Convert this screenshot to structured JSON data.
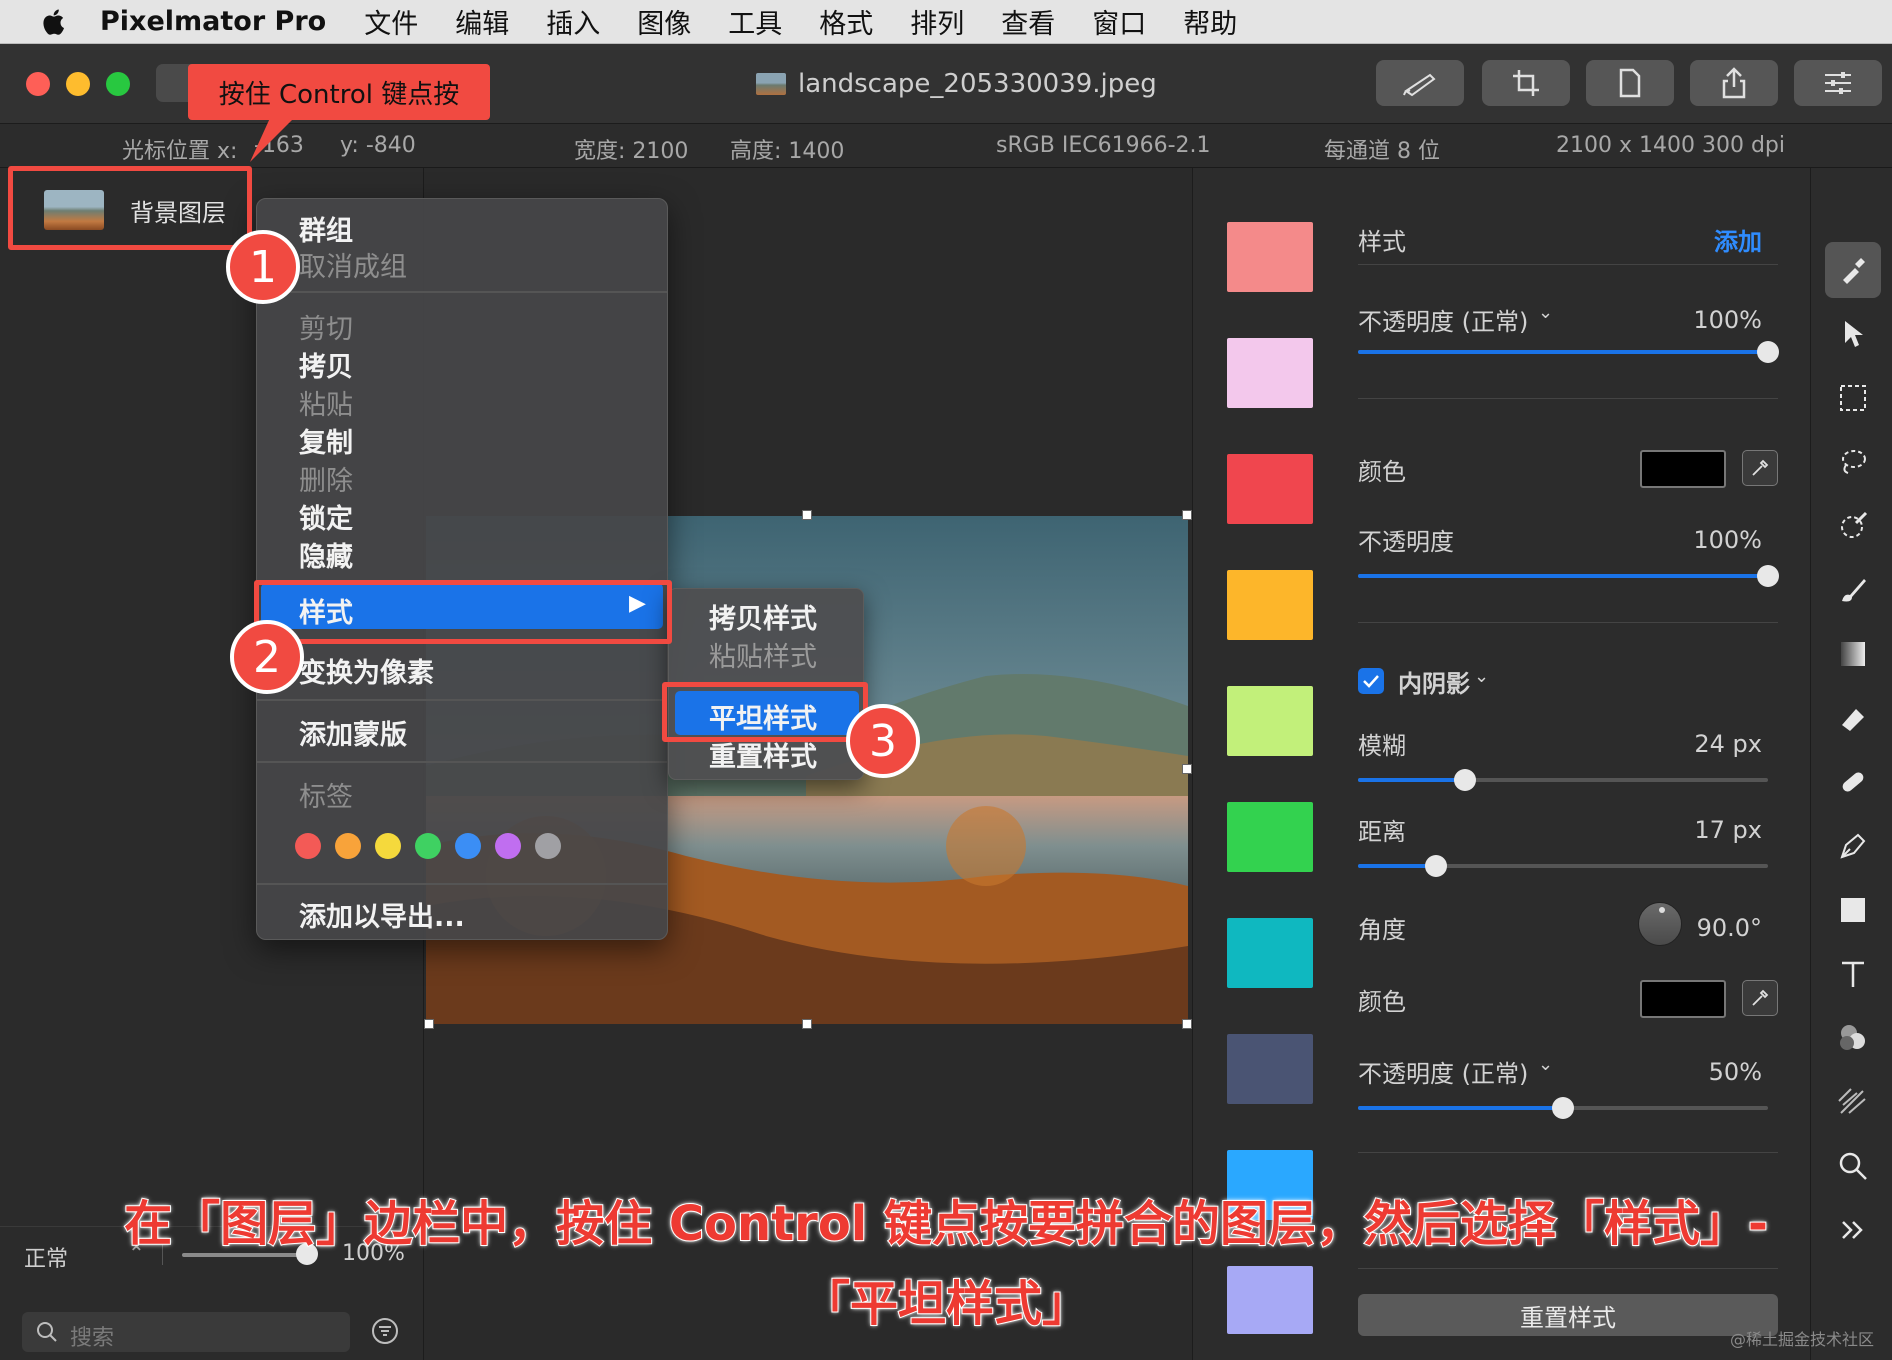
{
  "menubar": {
    "app_name": "Pixelmator Pro",
    "items": [
      "文件",
      "编辑",
      "插入",
      "图像",
      "工具",
      "格式",
      "排列",
      "查看",
      "窗口",
      "帮助"
    ]
  },
  "window": {
    "title": "landscape_205330039.jpeg"
  },
  "infobar": {
    "cursor_label": "光标位置 x:",
    "cursor_x": "-163",
    "cursor_y": "y:  -840",
    "width": "宽度:  2100",
    "height": "高度:  1400",
    "color_profile": "sRGB IEC61966-2.1",
    "bit_depth": "每通道 8 位",
    "dimensions": "2100 x 1400 300 dpi"
  },
  "layers": {
    "layer_name": "背景图层",
    "blend_mode": "正常",
    "opacity": "100%",
    "search_placeholder": "搜索"
  },
  "context_menu": {
    "group": "群组",
    "ungroup": "取消成组",
    "cut": "剪切",
    "copy": "拷贝",
    "paste": "粘贴",
    "duplicate": "复制",
    "delete": "删除",
    "lock": "锁定",
    "hide": "隐藏",
    "styles": "样式",
    "convert": "变换为像素",
    "add_mask": "添加蒙版",
    "tags": "标签",
    "tag_colors": [
      "#f35a56",
      "#f8a33a",
      "#f5d93c",
      "#3fd162",
      "#3b8ef5",
      "#c06ef0",
      "#a0a0a4"
    ],
    "add_export": "添加以导出..."
  },
  "submenu": {
    "copy_style": "拷贝样式",
    "paste_style": "粘贴样式",
    "flatten_style": "平坦样式",
    "reset_style": "重置样式"
  },
  "annotations": {
    "callout": "按住 Control 键点按",
    "badge1": "1",
    "badge2": "2",
    "badge3": "3",
    "caption_line1": "在「图层」边栏中，按住 Control 键点按要拼合的图层，然后选择「样式」-",
    "caption_line2": "「平坦样式」",
    "accent_color": "#f14a41"
  },
  "swatches": [
    "#f48a8a",
    "#f3c8ec",
    "#f0464e",
    "#fdb62a",
    "#c2f07a",
    "#33d24f",
    "#0fb8c0",
    "#4a5473",
    "#2aa8ff",
    "#a7a9f5"
  ],
  "inspector": {
    "styles_title": "样式",
    "add_label": "添加",
    "opacity_normal": "不透明度 (正常)",
    "opacity_normal_value": "100%",
    "opacity_normal_level": 1.0,
    "color_label": "颜色",
    "opacity_label": "不透明度",
    "opacity_value": "100%",
    "opacity_level": 1.0,
    "inner_shadow": "内阴影",
    "blur_label": "模糊",
    "blur_value": "24 px",
    "blur_level": 0.26,
    "distance_label": "距离",
    "distance_value": "17 px",
    "distance_level": 0.19,
    "angle_label": "角度",
    "angle_value": "90.0°",
    "color2_label": "颜色",
    "opacity2_label": "不透明度 (正常)",
    "opacity2_value": "50%",
    "opacity2_level": 0.5,
    "reset_button": "重置样式"
  },
  "watermark": "@稀土掘金技术社区"
}
